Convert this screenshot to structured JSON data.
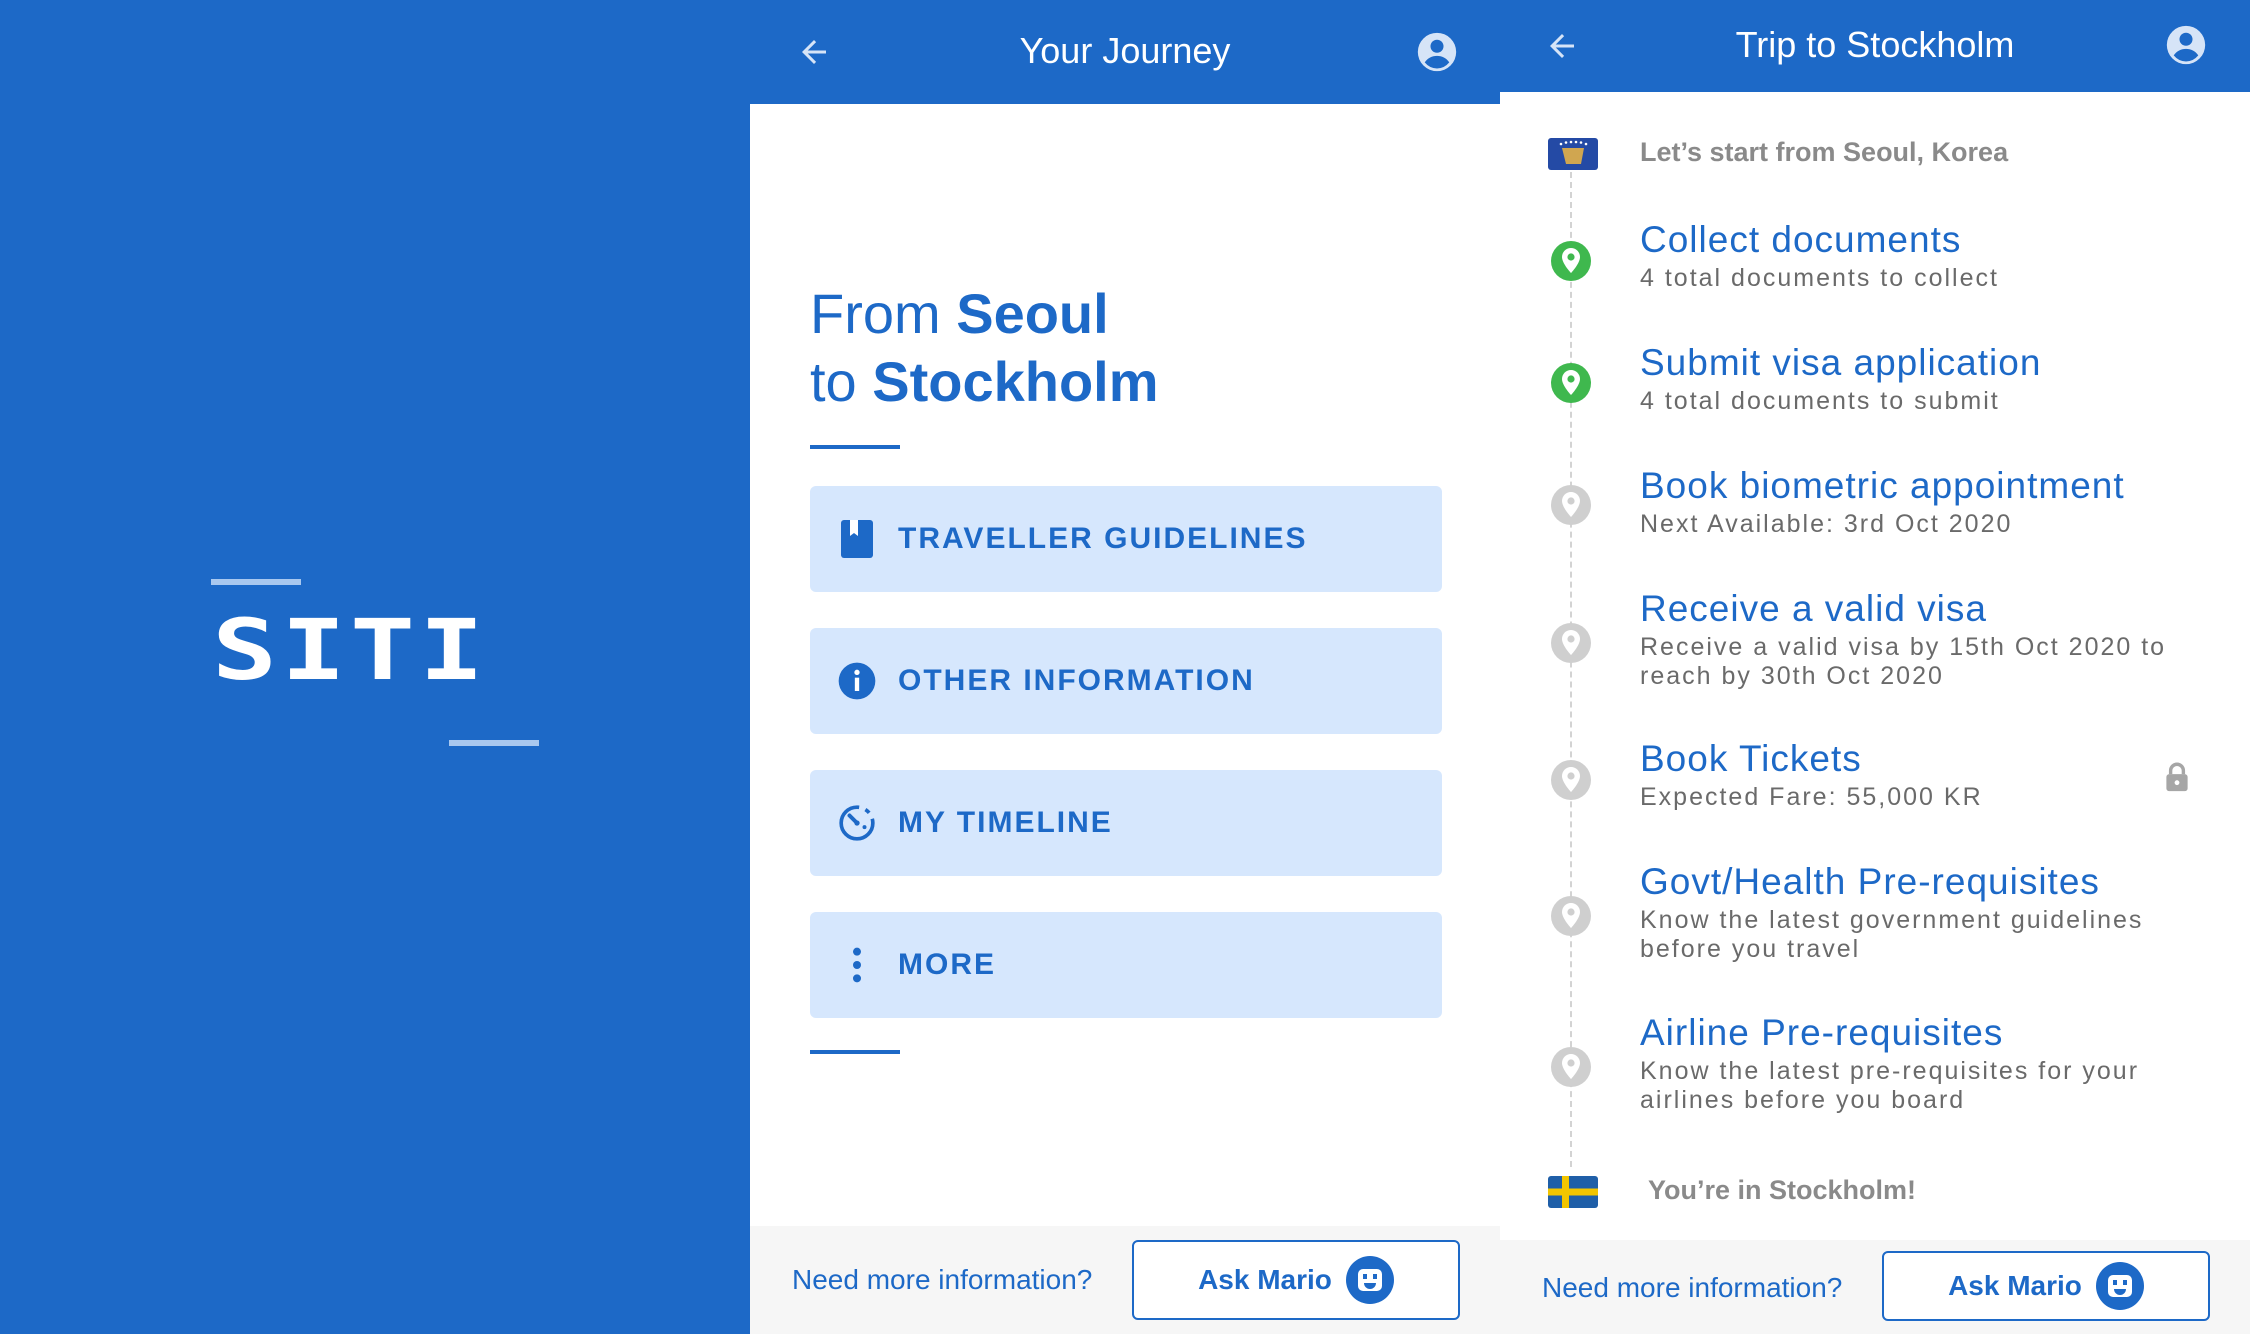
{
  "splash": {
    "logo": "SITI",
    "background_color": "#1d69c7"
  },
  "journey": {
    "header": {
      "title": "Your Journey",
      "back_icon": "arrow-left-icon",
      "account_icon": "account-circle-icon"
    },
    "route": {
      "from_prefix": "From",
      "from_city": "Seoul",
      "to_prefix": "to",
      "to_city": "Stockholm"
    },
    "menu": [
      {
        "label": "TRAVELLER GUIDELINES",
        "icon": "bookmark-book-icon"
      },
      {
        "label": "OTHER INFORMATION",
        "icon": "info-icon"
      },
      {
        "label": "MY TIMELINE",
        "icon": "timer-icon"
      },
      {
        "label": "MORE",
        "icon": "more-vertical-icon"
      }
    ],
    "footer": {
      "prompt": "Need more information?",
      "ask_label": "Ask Mario",
      "ask_icon": "bot-icon"
    }
  },
  "trip": {
    "header": {
      "title": "Trip to Stockholm",
      "back_icon": "arrow-left-icon",
      "account_icon": "account-circle-icon"
    },
    "start": {
      "text": "Let’s start from Seoul, Korea",
      "flag_icon": "flag-icon"
    },
    "steps": [
      {
        "title": "Collect documents",
        "desc": "4 total documents to collect",
        "status": "done"
      },
      {
        "title": "Submit visa application",
        "desc": "4 total documents to submit",
        "status": "done"
      },
      {
        "title": "Book biometric appointment",
        "desc": "Next Available: 3rd Oct 2020",
        "status": "pending"
      },
      {
        "title": "Receive a valid visa",
        "desc": "Receive a valid visa by 15th Oct 2020 to reach by 30th Oct 2020",
        "status": "pending"
      },
      {
        "title": "Book Tickets",
        "desc": "Expected Fare: 55,000 KR",
        "status": "pending",
        "locked": true
      },
      {
        "title": "Govt/Health Pre-requisites",
        "desc": "Know the latest government guidelines before you travel",
        "status": "pending"
      },
      {
        "title": "Airline Pre-requisites",
        "desc": "Know the latest pre-requisites for your airlines before you board",
        "status": "pending"
      }
    ],
    "end": {
      "text": "You’re in Stockholm!",
      "flag_icon": "sweden-flag-icon"
    },
    "footer": {
      "prompt": "Need more information?",
      "ask_label": "Ask Mario",
      "ask_icon": "bot-icon"
    }
  },
  "colors": {
    "primary": "#1d69c7",
    "button_bg": "#d6e7fd",
    "done_pin": "#3fb84e",
    "pending_pin": "#cfcfcf"
  }
}
